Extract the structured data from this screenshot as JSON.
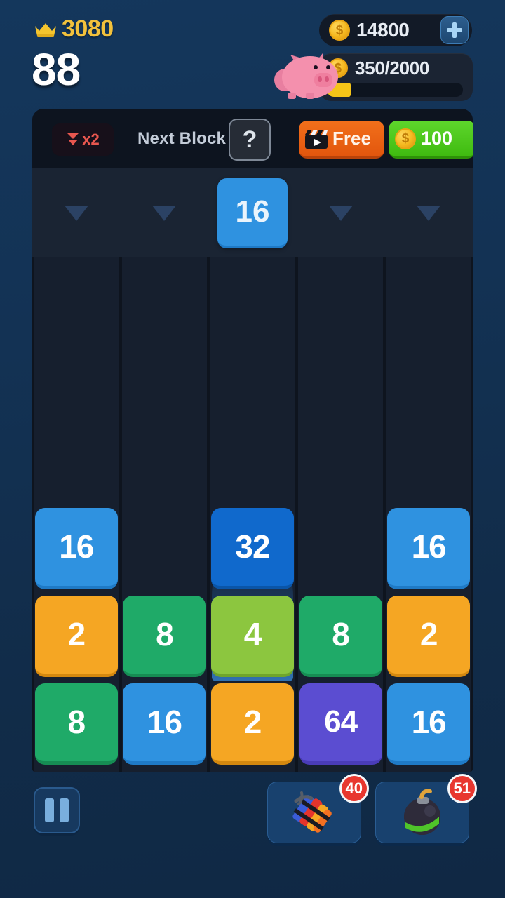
{
  "hud": {
    "crown_icon": "crown-icon",
    "crown_value": "3080",
    "level_value": "88",
    "coin_icon": "coin-icon",
    "coin_amount": "14800",
    "add_coins_icon": "plus-icon",
    "piggy_icon": "piggy-bank-icon",
    "piggy_coin_icon": "coin-icon",
    "piggy_progress_text": "350/2000",
    "piggy_current": 350,
    "piggy_max": 2000,
    "piggy_percent": 17.5
  },
  "board_header": {
    "multiplier_icon": "double-chevron-down-icon",
    "multiplier_label": "x2",
    "next_block_label": "Next Block",
    "help_label": "?",
    "free_icon": "video-clapperboard-icon",
    "free_label": "Free",
    "price_icon": "coin-icon",
    "price_label": "100"
  },
  "dropzone": {
    "arrow_icon": "arrow-down-icon",
    "active_column": 3,
    "active_block_value": "16",
    "active_block_color": "#2f92e0",
    "columns": [
      1,
      2,
      3,
      4,
      5
    ]
  },
  "field": {
    "columns": 5,
    "rows": [
      [
        {
          "value": "16",
          "color": "#2f92e0",
          "shadow": "#1f7ac6"
        },
        null,
        {
          "value": "32",
          "color": "#1069cc",
          "shadow": "#0a55a8",
          "effect": "landing-glow"
        },
        null,
        {
          "value": "16",
          "color": "#2f92e0",
          "shadow": "#1f7ac6"
        }
      ],
      [
        {
          "value": "2",
          "color": "#f5a623",
          "shadow": "#d4880f"
        },
        {
          "value": "8",
          "color": "#1faa68",
          "shadow": "#168c53"
        },
        {
          "value": "4",
          "color": "#8cc63f",
          "shadow": "#6fa52c"
        },
        {
          "value": "8",
          "color": "#1faa68",
          "shadow": "#168c53"
        },
        {
          "value": "2",
          "color": "#f5a623",
          "shadow": "#d4880f"
        }
      ],
      [
        {
          "value": "8",
          "color": "#1faa68",
          "shadow": "#168c53"
        },
        {
          "value": "16",
          "color": "#2f92e0",
          "shadow": "#1f7ac6"
        },
        {
          "value": "2",
          "color": "#f5a623",
          "shadow": "#d4880f"
        },
        {
          "value": "64",
          "color": "#5b4dd1",
          "shadow": "#4a3cb8"
        },
        {
          "value": "16",
          "color": "#2f92e0",
          "shadow": "#1f7ac6"
        }
      ]
    ]
  },
  "bottom": {
    "pause_icon": "pause-icon",
    "powerups": [
      {
        "icon": "dynamite-icon",
        "count": "40"
      },
      {
        "icon": "bomb-icon",
        "count": "51"
      }
    ]
  },
  "colors": {
    "background": "#123152",
    "board": "#141c29",
    "field": "#0e141e",
    "accent_gold": "#f2c13c",
    "badge_red": "#e8372f"
  }
}
